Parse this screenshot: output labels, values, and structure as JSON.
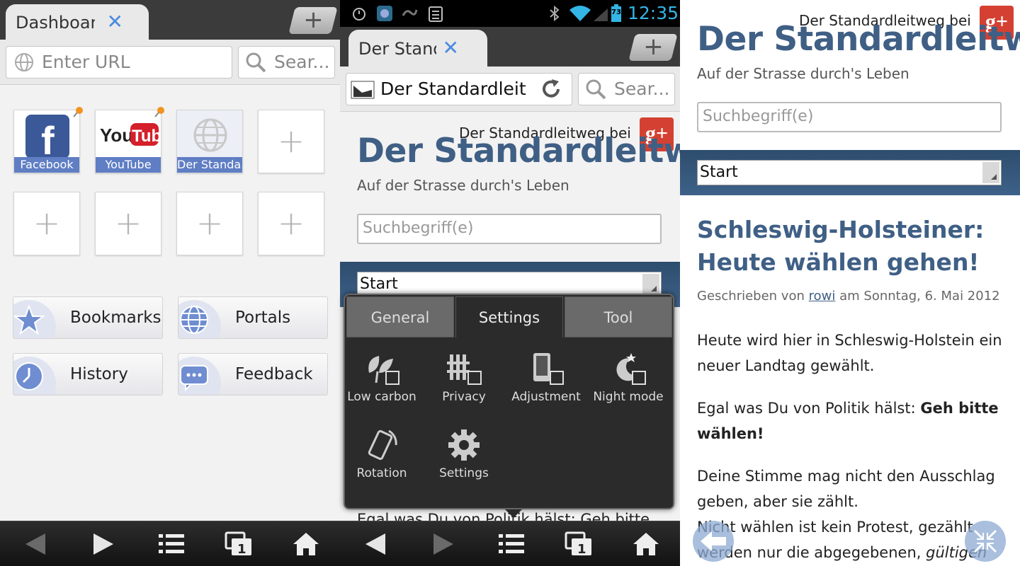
{
  "panel1": {
    "tab": {
      "title": "Dashboard",
      "close": "✕"
    },
    "new_tab": "+",
    "url_placeholder": "Enter URL",
    "search_placeholder": "Sear...",
    "dials": [
      {
        "label": "Facebook"
      },
      {
        "label": "YouTube"
      },
      {
        "label": "Der Standa.."
      }
    ],
    "plus": "+",
    "quick": [
      {
        "label": "Bookmarks"
      },
      {
        "label": "Portals"
      },
      {
        "label": "History"
      },
      {
        "label": "Feedback"
      }
    ]
  },
  "status": {
    "time": "12:35",
    "battery": "73"
  },
  "panel2": {
    "tab": {
      "title": "Der Standa",
      "close": "✕"
    },
    "new_tab": "+",
    "url_value": "Der Standardleitw",
    "search_placeholder": "Sear...",
    "gplus_text": "Der Standardleitweg bei",
    "blog_title": "Der Standardleitweg",
    "subtitle": "Auf der Strasse durch's Leben",
    "search_field": "Suchbegriff(e)",
    "select_value": "Start",
    "behind_text": "Egal was Du von Politik hälst: Geh bitte",
    "menu": {
      "tabs": [
        "General",
        "Settings",
        "Tool"
      ],
      "active_tab": "Settings",
      "items": [
        {
          "label": "Low carbon",
          "icon": "leaf-icon"
        },
        {
          "label": "Privacy",
          "icon": "privacy-icon"
        },
        {
          "label": "Adjustment",
          "icon": "adjustment-icon"
        },
        {
          "label": "Night mode",
          "icon": "night-mode-icon"
        },
        {
          "label": "Rotation",
          "icon": "rotation-icon"
        },
        {
          "label": "Settings",
          "icon": "gear-icon"
        }
      ]
    }
  },
  "panel3": {
    "gplus_text": "Der Standardleitweg bei",
    "blog_title": "Der Standardleitweg",
    "subtitle": "Auf der Strasse durch's Leben",
    "search_field": "Suchbegriff(e)",
    "select_value": "Start",
    "post_title_1": "Schleswig-Holsteiner:",
    "post_title_2": "Heute wählen gehen!",
    "meta_prefix": "Geschrieben von",
    "meta_author": "rowi",
    "meta_suffix": "am Sonntag, 6. Mai 2012",
    "para1": "Heute wird hier in Schleswig-Holstein ein neuer Landtag gewählt.",
    "para2_plain": "Egal was Du von Politik hälst:",
    "para2_bold": "Geh bitte wählen!",
    "para3": "Deine Stimme mag nicht den Ausschlag geben, aber sie zählt.",
    "para4_plain": "Nicht wählen ist kein Protest, gezählt werden nur die abgegebenen,",
    "para4_italic": "gültigen"
  },
  "gplus_glyph": "g+",
  "colors": {
    "accent": "#3f5f85",
    "tab_label": "#5f7ec4",
    "status_blue": "#33b5e5"
  }
}
